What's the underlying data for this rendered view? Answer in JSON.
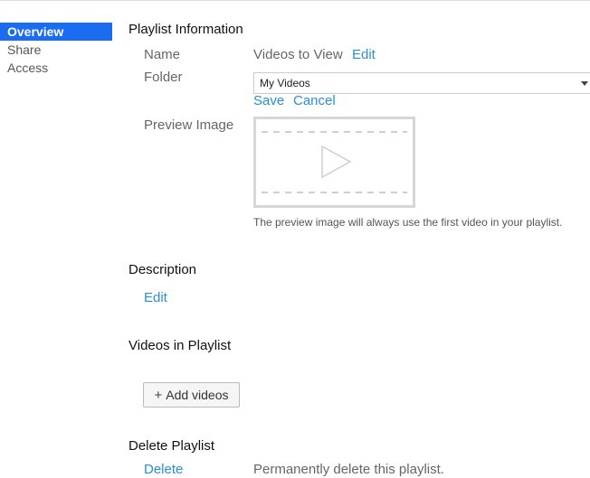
{
  "sidebar": {
    "items": [
      {
        "label": "Overview",
        "active": true
      },
      {
        "label": "Share",
        "active": false
      },
      {
        "label": "Access",
        "active": false
      }
    ]
  },
  "info": {
    "title": "Playlist Information",
    "name_label": "Name",
    "name_value": "Videos to View",
    "name_edit": "Edit",
    "folder_label": "Folder",
    "folder_selected": "My Videos",
    "save_label": "Save",
    "cancel_label": "Cancel",
    "preview_label": "Preview Image",
    "preview_icon": "play-icon",
    "preview_help": "The preview image will always use the first video in your playlist."
  },
  "description": {
    "title": "Description",
    "edit_label": "Edit"
  },
  "videos": {
    "title": "Videos in Playlist",
    "add_icon": "plus-icon",
    "add_label": "Add videos"
  },
  "delete": {
    "title": "Delete Playlist",
    "delete_label": "Delete",
    "delete_text": "Permanently delete this playlist."
  },
  "colors": {
    "accent": "#1a6cf0",
    "link": "#2a8fd1"
  }
}
